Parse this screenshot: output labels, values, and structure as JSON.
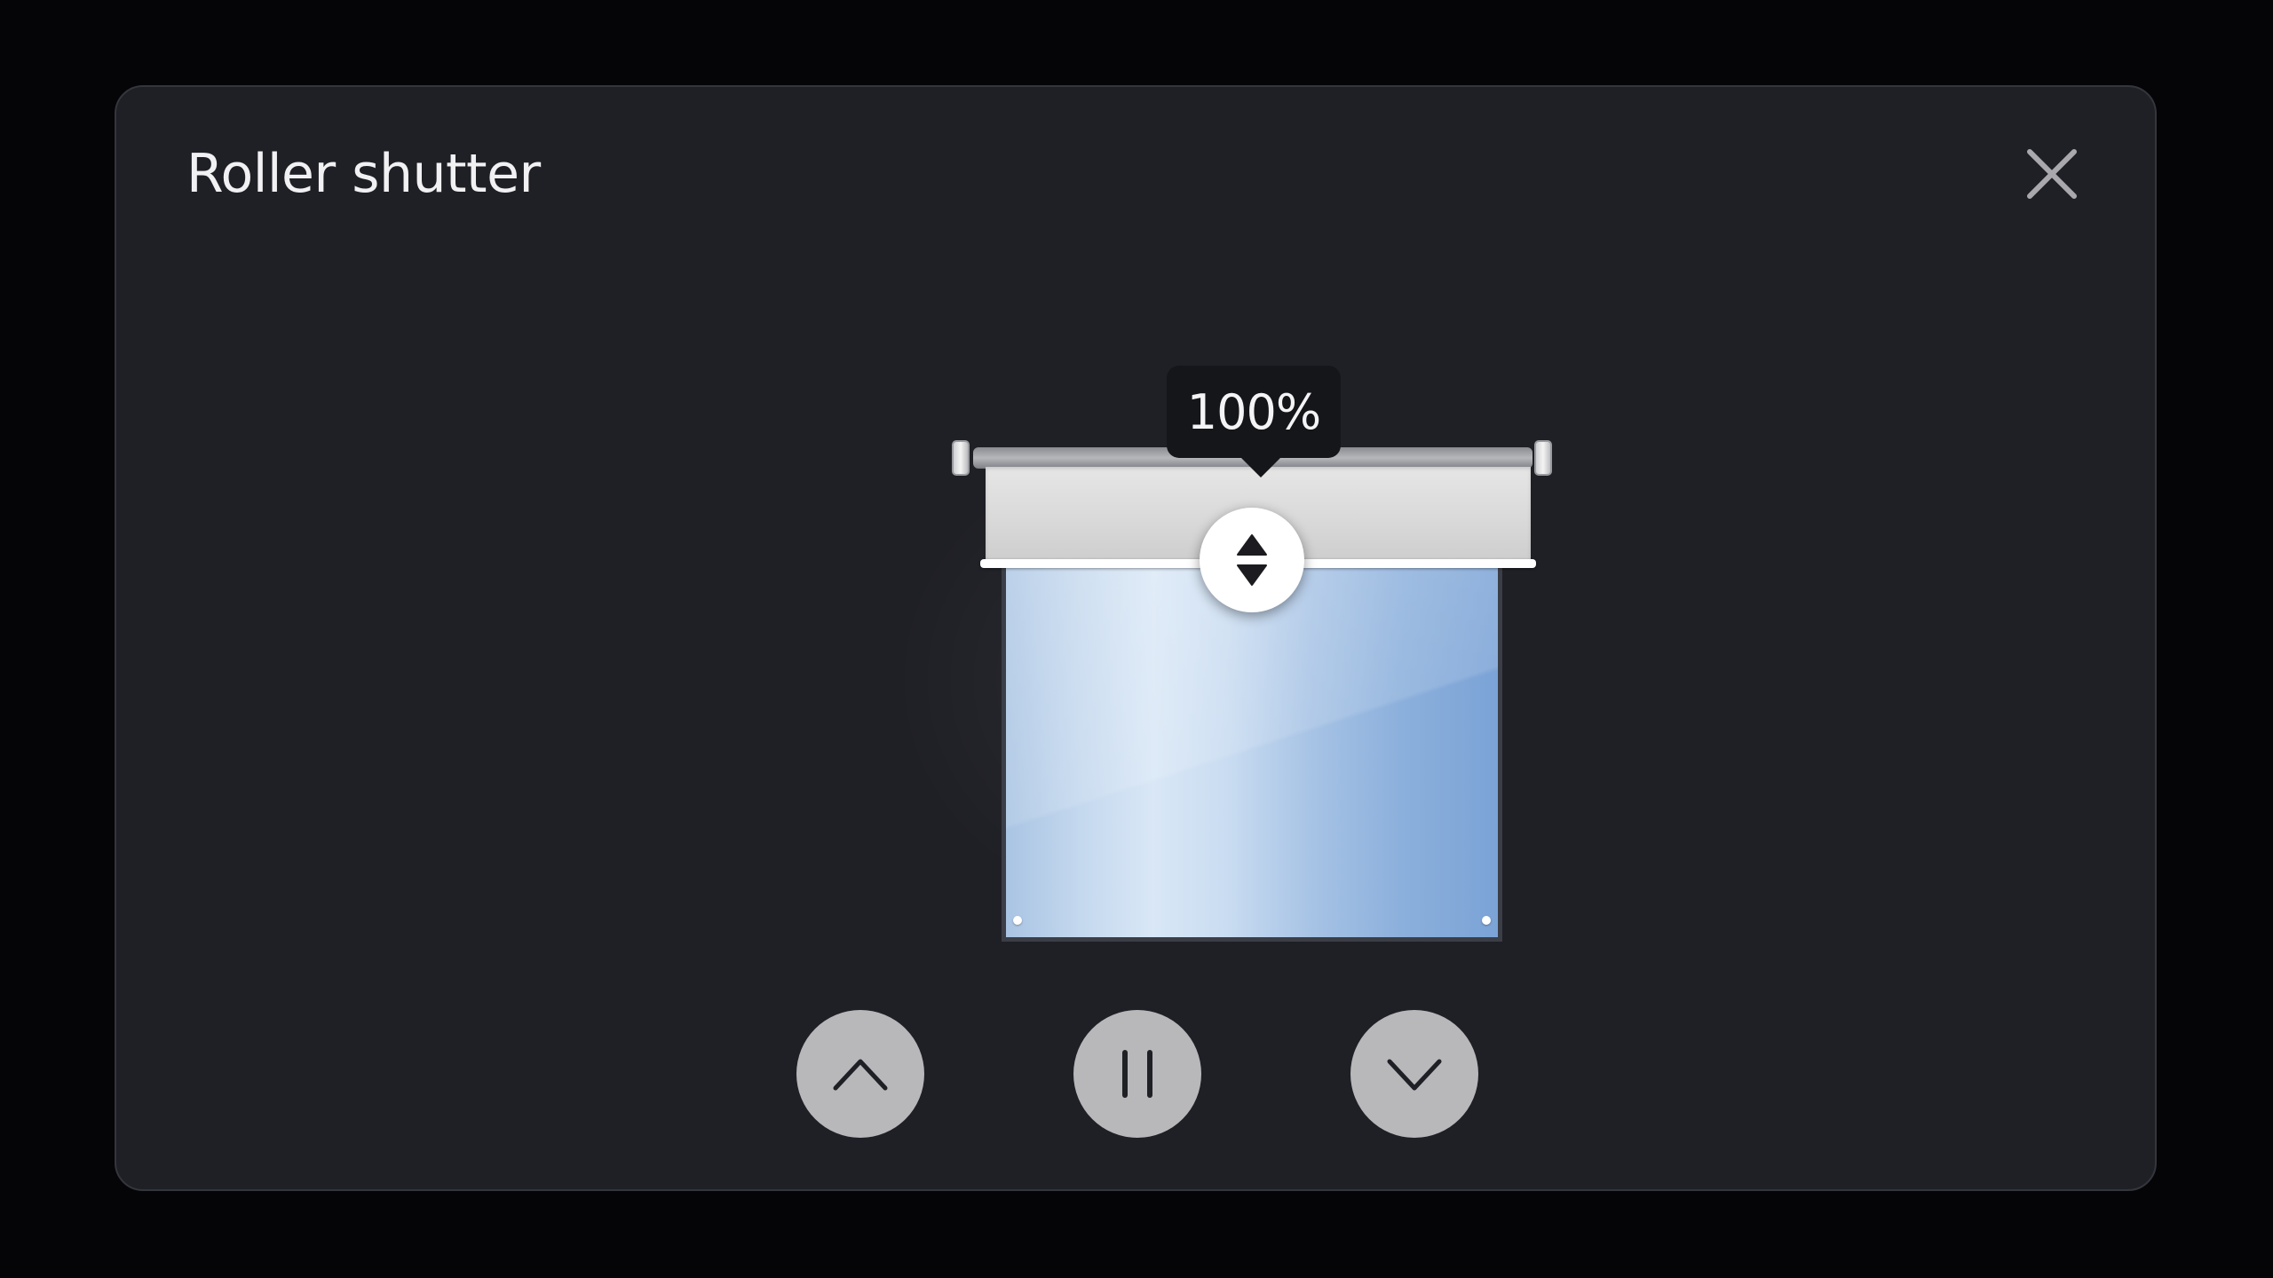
{
  "dialog": {
    "title": "Roller shutter",
    "close_icon": "close-icon"
  },
  "shutter": {
    "position_label": "100%",
    "position_percent": 100,
    "handle_icon": "up-down-arrows-icon",
    "colors": {
      "glass": "#a7c3e5",
      "fabric": "#dcdcdc",
      "frame": "#3b3e46"
    }
  },
  "controls": {
    "up_icon": "chevron-up-icon",
    "pause_icon": "pause-icon",
    "down_icon": "chevron-down-icon",
    "button_color": "#b8b8ba"
  },
  "theme": {
    "background": "#050508",
    "panel": "#1f2026"
  }
}
